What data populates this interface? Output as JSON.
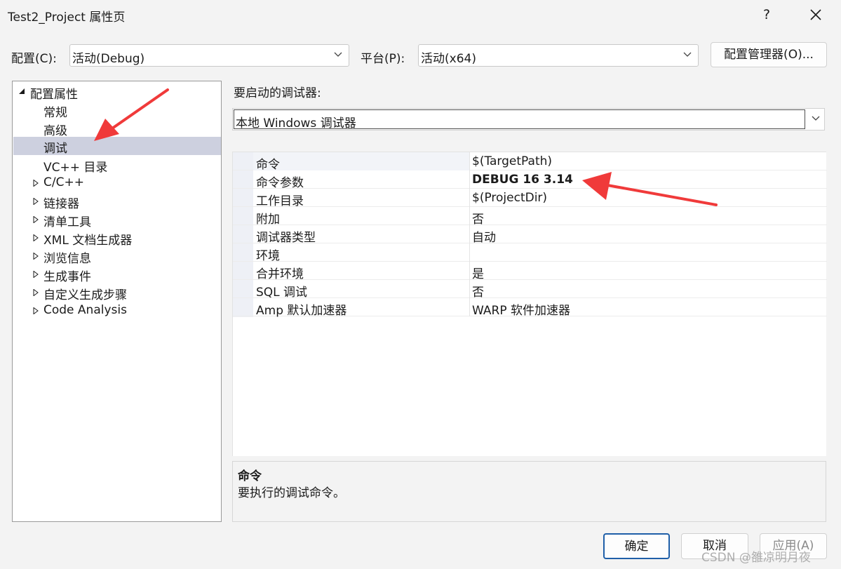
{
  "window": {
    "title": "Test2_Project 属性页",
    "help_label": "?",
    "close_icon": "close-icon"
  },
  "config": {
    "config_label": "配置(C):",
    "config_value": "活动(Debug)",
    "platform_label": "平台(P):",
    "platform_value": "活动(x64)",
    "manager_button": "配置管理器(O)..."
  },
  "tree": {
    "root": "配置属性",
    "items": [
      {
        "label": "常规"
      },
      {
        "label": "高级"
      },
      {
        "label": "调试",
        "selected": true
      },
      {
        "label": "VC++ 目录"
      },
      {
        "label": "C/C++"
      },
      {
        "label": "链接器"
      },
      {
        "label": "清单工具"
      },
      {
        "label": "XML 文档生成器"
      },
      {
        "label": "浏览信息"
      },
      {
        "label": "生成事件"
      },
      {
        "label": "自定义生成步骤"
      },
      {
        "label": "Code Analysis"
      }
    ]
  },
  "debugger": {
    "label": "要启动的调试器:",
    "value": "本地 Windows 调试器"
  },
  "properties": [
    {
      "name": "命令",
      "value": "$(TargetPath)"
    },
    {
      "name": "命令参数",
      "value": "DEBUG 16 3.14"
    },
    {
      "name": "工作目录",
      "value": "$(ProjectDir)"
    },
    {
      "name": "附加",
      "value": "否"
    },
    {
      "name": "调试器类型",
      "value": "自动"
    },
    {
      "name": "环境",
      "value": ""
    },
    {
      "name": "合并环境",
      "value": "是"
    },
    {
      "name": "SQL 调试",
      "value": "否"
    },
    {
      "name": "Amp 默认加速器",
      "value": "WARP 软件加速器"
    }
  ],
  "description": {
    "title": "命令",
    "text": "要执行的调试命令。"
  },
  "buttons": {
    "ok": "确定",
    "cancel": "取消",
    "apply": "应用(A)"
  },
  "watermark": "CSDN @雒凉明月夜",
  "colors": {
    "selection": "#cdd0df",
    "annotation_arrow": "#f03a3a",
    "ok_border": "#1f5fa8"
  }
}
